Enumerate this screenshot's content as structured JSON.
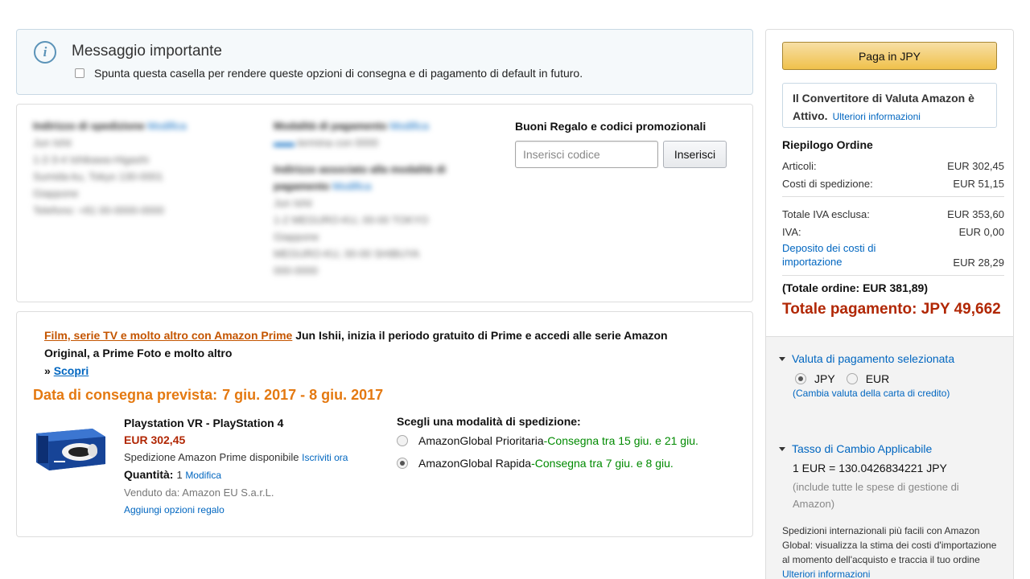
{
  "message": {
    "title": "Messaggio importante",
    "checkbox_label": "Spunta questa casella per rendere queste opzioni di consegna e di pagamento di default in futuro."
  },
  "address": {
    "shipping_title": "Indirizzo di spedizione",
    "shipping_edit": "Modifica",
    "shipping_lines": [
      "Jun Ishii",
      "1-2-3-4 Ishikawa-Higashi",
      "Sumida-ku, Tokyo 130-0001",
      "Giappone",
      "Telefono: +81 00-0000-0000"
    ],
    "payment_title": "Modalità di pagamento",
    "payment_edit": "Modifica",
    "payment_card": "termina con 0000",
    "billing_title": "Indirizzo associato alla modalità di pagamento",
    "billing_edit": "Modifica",
    "billing_lines": [
      "Jun Ishii",
      "1-2 MEGURO-KU, 00-00 TOKYO",
      "Giappone",
      "MEGURO-KU, 00-00 SHIBUYA",
      "000-0000"
    ]
  },
  "gift": {
    "title": "Buoni Regalo e codici promozionali",
    "placeholder": "Inserisci codice",
    "button": "Inserisci"
  },
  "promo": {
    "link": "Film, serie TV e molto altro con Amazon Prime",
    "text": "Jun Ishii, inizia il periodo gratuito di Prime e accedi alle serie Amazon Original, a Prime Foto e molto altro",
    "arrow": "»",
    "discover": "Scopri"
  },
  "delivery": {
    "label": "Data di consegna prevista:",
    "dates": "7 giu. 2017 - 8 giu. 2017"
  },
  "product": {
    "name": "Playstation VR - PlayStation 4",
    "price": "EUR 302,45",
    "shipping": "Spedizione Amazon Prime disponibile",
    "subscribe": "Iscriviti ora",
    "qty_label": "Quantità:",
    "qty": "1",
    "qty_edit": "Modifica",
    "seller": "Venduto da: Amazon EU S.a.r.L.",
    "gift_options": "Aggiungi opzioni regalo"
  },
  "shipping_options": {
    "title": "Scegli una modalità di spedizione:",
    "options": [
      {
        "name": "AmazonGlobal Prioritaria",
        "sep": " - ",
        "delivery": "Consegna tra 15 giu. e 21 giu.",
        "selected": false
      },
      {
        "name": "AmazonGlobal Rapida",
        "sep": " - ",
        "delivery": "Consegna tra 7 giu. e 8 giu.",
        "selected": true
      }
    ]
  },
  "sidebar": {
    "pay_button": "Paga in JPY",
    "converter_text": "Il Convertitore di Valuta Amazon è Attivo.",
    "converter_link": "Ulteriori informazioni",
    "summary_title": "Riepilogo Ordine",
    "items_label": "Articoli:",
    "items_value": "EUR 302,45",
    "shipping_label": "Costi di spedizione:",
    "shipping_value": "EUR 51,15",
    "total_excl_label": "Totale IVA esclusa:",
    "total_excl_value": "EUR 353,60",
    "vat_label": "IVA:",
    "vat_value": "EUR 0,00",
    "import_label": "Deposito dei costi di importazione",
    "import_value": "EUR 28,29",
    "order_total": "(Totale ordine: EUR 381,89)",
    "payment_total": "Totale pagamento: JPY 49,662",
    "currency_section": "Valuta di pagamento selezionata",
    "currency_jpy": "JPY",
    "currency_eur": "EUR",
    "currency_change": "(Cambia valuta della carta di credito)",
    "rate_section": "Tasso di Cambio Applicabile",
    "rate_value": "1 EUR = 130.0426834221 JPY",
    "rate_note": "(include tutte le spese di gestione di Amazon)",
    "global_info": "Spedizioni internazionali più facili con Amazon Global: visualizza la stima dei costi d'importazione al momento dell'acquisto e traccia il tuo ordine",
    "global_link": "Ulteriori informazioni"
  },
  "colors": {
    "link": "#0066c0",
    "price": "#b12704",
    "delivery_date": "#e47911",
    "promo_link": "#c45500",
    "delivery_green": "#008a00",
    "pay_button": "#f0c14b"
  }
}
